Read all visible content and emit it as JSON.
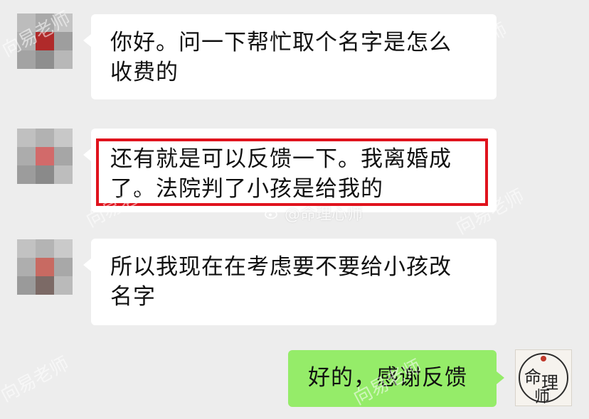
{
  "messages": [
    {
      "lines": [
        "你好。问一下帮忙取个名字是怎么",
        "收费的"
      ]
    },
    {
      "lines": [
        "还有就是可以反馈一下。我离婚成",
        "了。法院判了小孩是给我的"
      ]
    },
    {
      "lines": [
        "所以我现在在考虑要不要给小孩改",
        "名字"
      ]
    },
    {
      "lines": [
        "好的，感谢反馈"
      ]
    }
  ],
  "watermark": {
    "text": "向易老师",
    "weibo": "@命理心师"
  },
  "colors": {
    "background": "#ededed",
    "incoming_bubble": "#ffffff",
    "outgoing_bubble": "#95ec69",
    "highlight": "#e0131d"
  }
}
